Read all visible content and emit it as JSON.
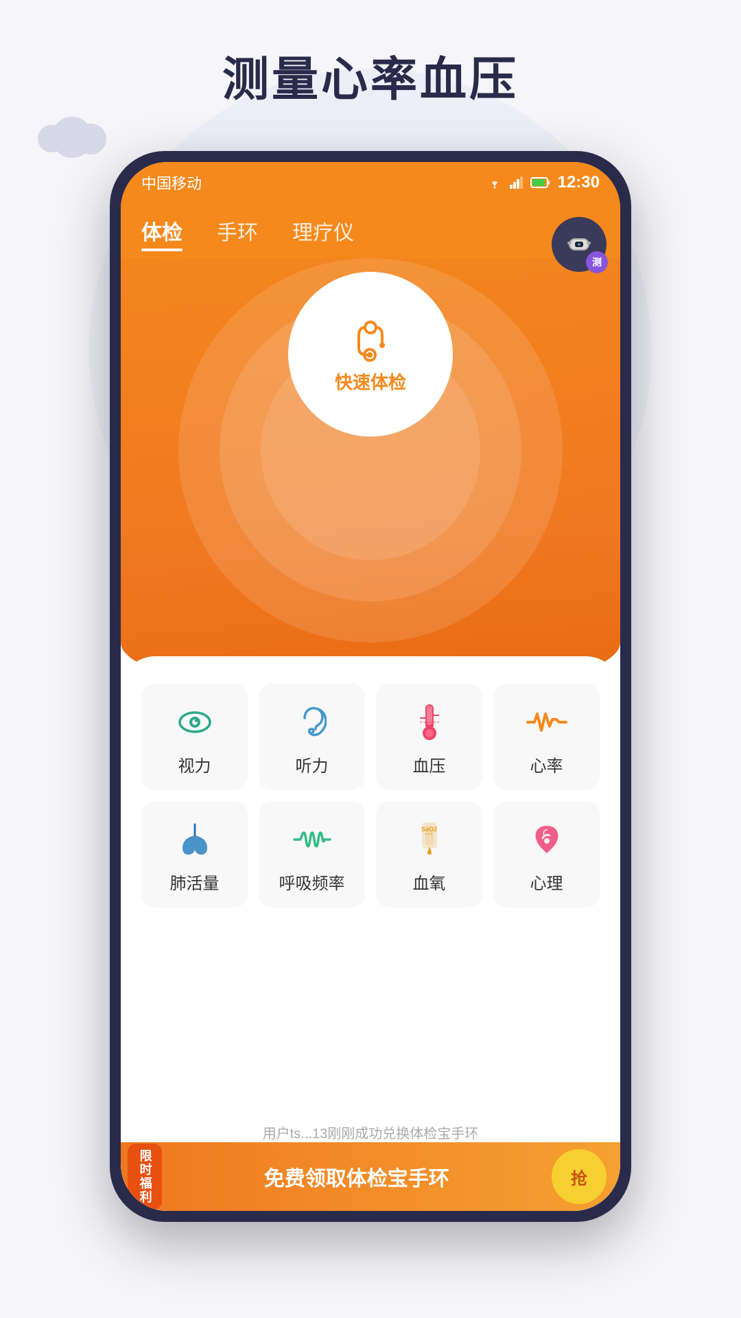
{
  "page": {
    "title": "测量心率血压",
    "background_color": "#f5f5fa"
  },
  "status_bar": {
    "carrier": "中国移动",
    "time": "12:30",
    "wifi": true,
    "signal": true,
    "battery": true
  },
  "nav": {
    "tabs": [
      {
        "id": "exam",
        "label": "体检",
        "active": true
      },
      {
        "id": "band",
        "label": "手环",
        "active": false
      },
      {
        "id": "therapy",
        "label": "理疗仪",
        "active": false
      }
    ]
  },
  "hero": {
    "center_button_label": "快速体检",
    "wristband_badge": "测"
  },
  "health_items": [
    {
      "id": "vision",
      "label": "视力",
      "icon": "eye"
    },
    {
      "id": "hearing",
      "label": "听力",
      "icon": "ear"
    },
    {
      "id": "bp",
      "label": "血压",
      "icon": "thermometer"
    },
    {
      "id": "heartrate",
      "label": "心率",
      "icon": "heartrate"
    },
    {
      "id": "lung",
      "label": "肺活量",
      "icon": "lung"
    },
    {
      "id": "breath",
      "label": "呼吸频率",
      "icon": "breath"
    },
    {
      "id": "spo2",
      "label": "血氧",
      "icon": "spo2"
    },
    {
      "id": "mental",
      "label": "心理",
      "icon": "mental"
    }
  ],
  "notification": {
    "text": "用户ts...13刚刚成功兑换体检宝手环"
  },
  "banner": {
    "badge_text": "限时福利",
    "main_text": "免费领取体检宝手环",
    "button_text": "抢"
  }
}
